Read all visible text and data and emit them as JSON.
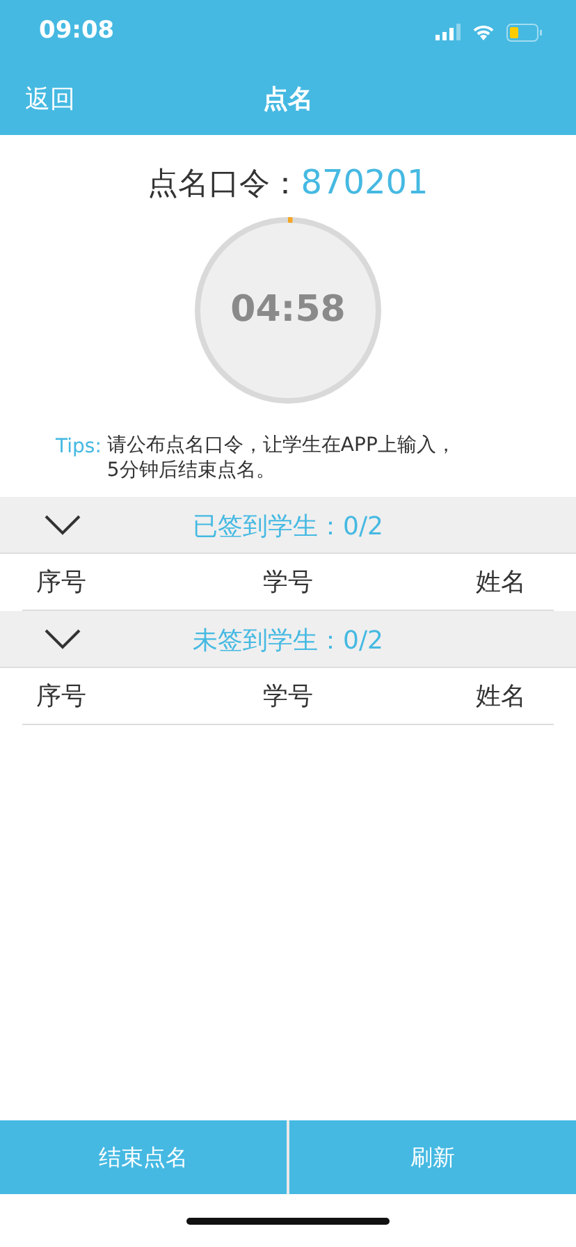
{
  "status_bar": {
    "time": "09:08"
  },
  "nav": {
    "back": "返回",
    "title": "点名"
  },
  "command": {
    "label": "点名口令：",
    "code": "870201"
  },
  "timer": {
    "time": "04:58",
    "level": 0.008
  },
  "tips": {
    "label": "Tips:",
    "text": "请公布点名口令，让学生在APP上输入，\n5分钟后结束点名。"
  },
  "sections": [
    {
      "title": "已签到学生：0/2",
      "expanded": true,
      "columns": [
        "序号",
        "学号",
        "姓名"
      ]
    },
    {
      "title": "未签到学生：0/2",
      "expanded": true,
      "columns": [
        "序号",
        "学号",
        "姓名"
      ]
    }
  ],
  "buttons": [
    "结束点名",
    "刷新"
  ]
}
